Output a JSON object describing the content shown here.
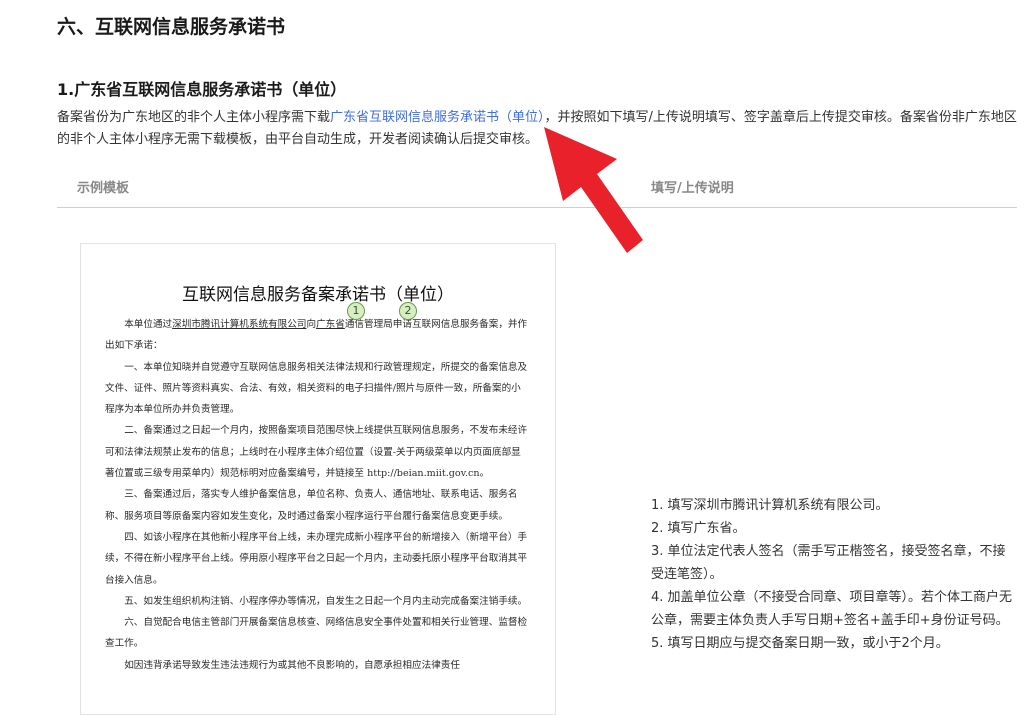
{
  "section_heading": "六、互联网信息服务承诺书",
  "subsection_heading": "1.广东省互联网信息服务承诺书（单位）",
  "intro": {
    "text_before": "备案省份为广东地区的非个人主体小程序需下载",
    "link_label": "广东省互联网信息服务承诺书（单位）",
    "text_after": "，并按照如下填写/上传说明填写、签字盖章后上传提交审核。备案省份非广东地区的非个人主体小程序无需下载模板，由平台自动生成，开发者阅读确认后提交审核。"
  },
  "table_headers": {
    "example": "示例模板",
    "instructions": "填写/上传说明"
  },
  "document": {
    "title": "互联网信息服务备案承诺书（单位）",
    "line1_prefix": "本单位通过",
    "company": "深圳市腾讯计算机系统有限公司",
    "line1_mid": "向",
    "province": "广东省",
    "line1_suffix": "通信管理局申请互联网信息服务备案，并作出如下承诺：",
    "paragraphs": [
      "一、本单位知晓并自觉遵守互联网信息服务相关法律法规和行政管理规定，所提交的备案信息及文件、证件、照片等资料真实、合法、有效，相关资料的电子扫描件/照片与原件一致，所备案的小程序为本单位所办并负责管理。",
      "二、备案通过之日起一个月内，按照备案项目范围尽快上线提供互联网信息服务，不发布未经许可和法律法规禁止发布的信息；上线时在小程序主体介绍位置（设置-关于两级菜单以内页面底部显著位置或三级专用菜单内）规范标明对应备案编号，并链接至 http://beian.miit.gov.cn。",
      "三、备案通过后，落实专人维护备案信息，单位名称、负责人、通信地址、联系电话、服务名称、服务项目等原备案内容如发生变化，及时通过备案小程序运行平台履行备案信息变更手续。",
      "四、如该小程序在其他新小程序平台上线，未办理完成新小程序平台的新增接入（新增平台）手续，不得在新小程序平台上线。停用原小程序平台之日起一个月内，主动委托原小程序平台取消其平台接入信息。",
      "五、如发生组织机构注销、小程序停办等情况，自发生之日起一个月内主动完成备案注销手续。",
      "六、自觉配合电信主管部门开展备案信息核查、网络信息安全事件处置和相关行业管理、监督检查工作。",
      "如因违背承诺导致发生违法违规行为或其他不良影响的，自愿承担相应法律责任"
    ],
    "markers": [
      "1",
      "2"
    ]
  },
  "instructions": [
    "1. 填写深圳市腾讯计算机系统有限公司。",
    "2. 填写广东省。",
    "3. 单位法定代表人签名（需手写正楷签名，接受签名章，不接受连笔签）。",
    "4. 加盖单位公章（不接受合同章、项目章等）。若个体工商户无公章，需要主体负责人手写日期+签名+盖手印+身份证号码。",
    "5. 填写日期应与提交备案日期一致，或小于2个月。"
  ],
  "colors": {
    "link": "#3f6ee0",
    "arrow": "#e8212a",
    "marker_fill": "#d7eec4"
  }
}
